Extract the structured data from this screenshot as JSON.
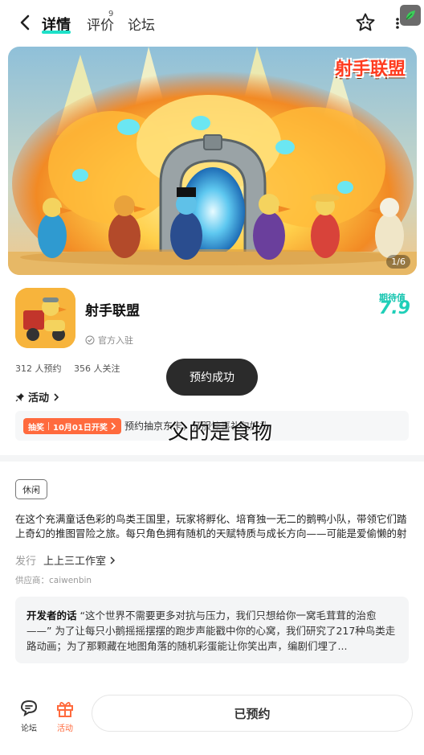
{
  "nav": {
    "tabs": [
      {
        "label": "详情",
        "active": true
      },
      {
        "label": "评价",
        "badge": "9"
      },
      {
        "label": "论坛"
      }
    ],
    "icons": [
      "back-arrow-icon",
      "star-icon",
      "more-icon",
      "leaf-icon"
    ]
  },
  "banner": {
    "logo_text": "射手联盟",
    "counter": "1/6"
  },
  "game": {
    "title": "射手联盟",
    "official": "官方入驻",
    "expect_label": "期待值",
    "expect_value": "7.9",
    "reservations": "312 人预约",
    "followers": "356 人关注"
  },
  "toast": "预约成功",
  "activity": {
    "heading": "活动",
    "badge_type": "抽奖",
    "badge_date": "10月01日开奖",
    "text": "预约抽京东卡，开服惊喜礼包好礼"
  },
  "overlay_caption": "父的是食物",
  "details": {
    "tag": "休闲",
    "description": "在这个充满童话色彩的鸟类王国里，玩家将孵化、培育独一无二的鹅鸭小队，带领它们踏上奇幻的推图冒险之旅。每只角色拥有随机的天赋特质与成长方向——可能是爱偷懒的射手，也可能是勇敢的守卫……",
    "publisher_label": "发行",
    "publisher_name": "上上三工作室",
    "supplier": "供应商：caiwenbin",
    "dev_words_label": "开发者的话",
    "dev_words": "“这个世界不需要更多对抗与压力，我们只想给你一窝毛茸茸的治愈——” 为了让每只小鹅摇摇摆摆的跑步声能戳中你的心窝，我们研究了217种鸟类走路动画；为了那颗藏在地图角落的随机彩蛋能让你笑出声，编剧们埋了..."
  },
  "bottom": {
    "forum_label": "论坛",
    "activity_label": "活动",
    "reserved_label": "已预约"
  },
  "colors": {
    "accent": "#1ee0c8",
    "expect": "#1fcfb8",
    "activity_orange": "#ff6a3d"
  }
}
